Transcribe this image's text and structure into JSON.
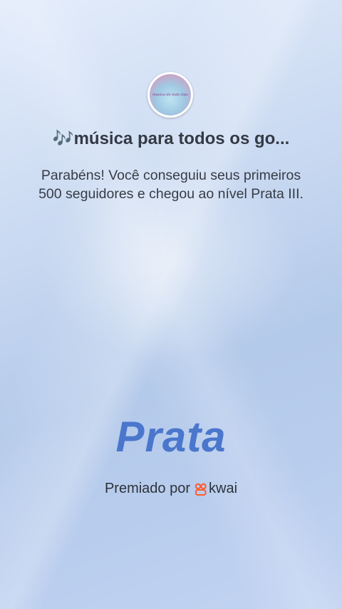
{
  "profile": {
    "avatar_text": "musica de todo tipo",
    "title": "🎶música para todos os go..."
  },
  "message": "Parabéns! Você conseguiu seus primeiros 500 seguidores e chegou ao nível Prata III.",
  "tier": "Prata",
  "awarded": {
    "label": "Premiado por",
    "brand": "kwai",
    "brand_icon": "kwai-logo-icon"
  },
  "colors": {
    "tier": "#4a76cc",
    "brand_icon": "#ff5b2d"
  }
}
